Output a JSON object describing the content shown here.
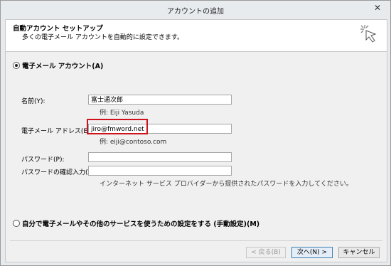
{
  "window": {
    "title": "アカウントの追加",
    "close_glyph": "✕"
  },
  "header": {
    "title": "自動アカウント セットアップ",
    "subtitle": "多くの電子メール アカウントを自動的に設定できます。"
  },
  "options": {
    "email_account": {
      "label": "電子メール アカウント(A)",
      "selected": true
    },
    "manual_setup": {
      "label": "自分で電子メールやその他のサービスを使うための設定をする (手動設定)(M)",
      "selected": false
    }
  },
  "form": {
    "name": {
      "label": "名前(Y):",
      "value": "富士通次郎",
      "hint": "例: Eiji Yasuda"
    },
    "email": {
      "label": "電子メール アドレス(E):",
      "value": "jiro@fmword.net",
      "hint": "例: eiji@contoso.com"
    },
    "password": {
      "label": "パスワード(P):",
      "value": ""
    },
    "password_confirm": {
      "label": "パスワードの確認入力(T):",
      "value": ""
    },
    "password_hint": "インターネット サービス プロバイダーから提供されたパスワードを入力してください。"
  },
  "buttons": {
    "back": "< 戻る(B)",
    "next": "次へ(N) >",
    "cancel": "キャンセル"
  },
  "colors": {
    "highlight": "#d0121b",
    "primary_border": "#3c7fb1"
  }
}
